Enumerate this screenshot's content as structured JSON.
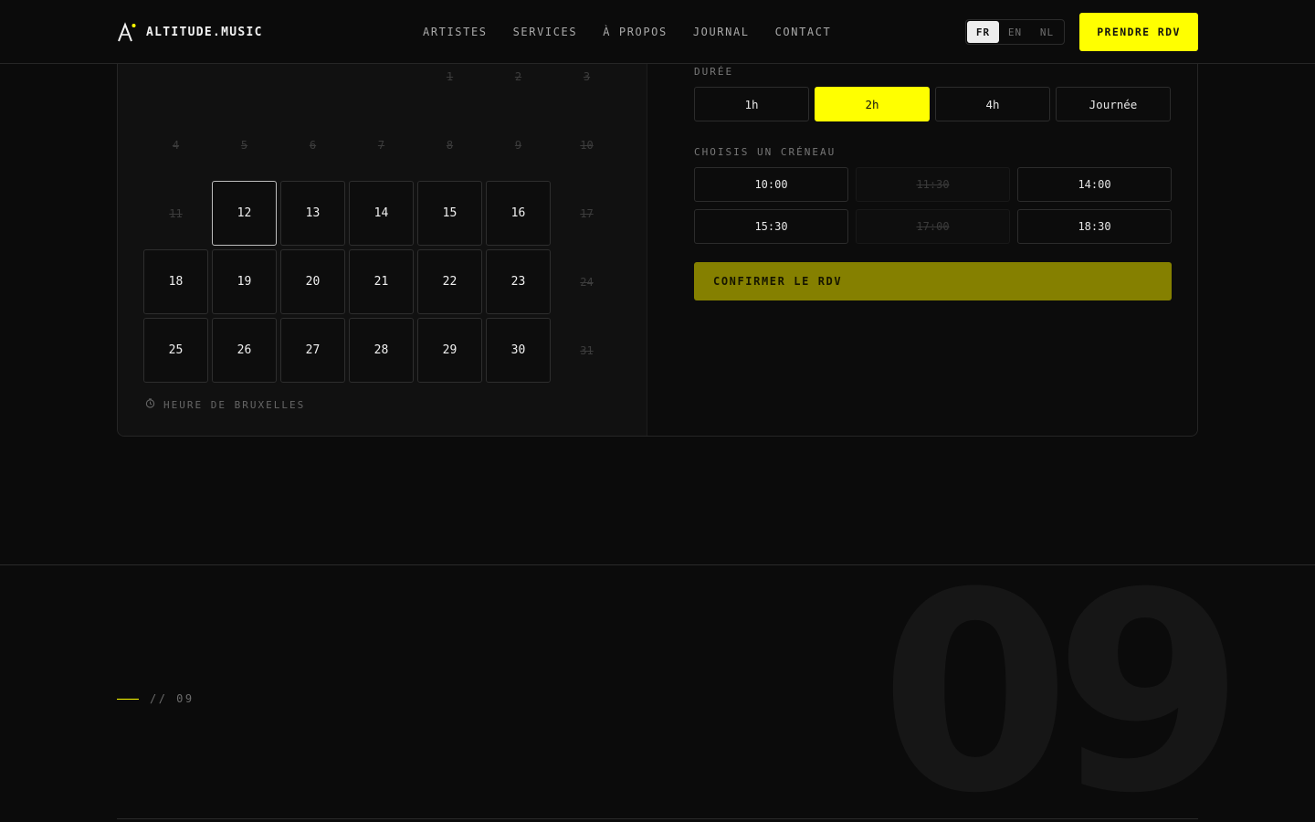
{
  "brand": {
    "name": "ALTITUDE.MUSIC",
    "accent": "#ffff00"
  },
  "nav": {
    "items": [
      "ARTISTES",
      "SERVICES",
      "À PROPOS",
      "JOURNAL",
      "CONTACT"
    ]
  },
  "lang": {
    "options": [
      "FR",
      "EN",
      "NL"
    ],
    "active": "FR"
  },
  "cta": {
    "label": "PRENDRE RDV"
  },
  "calendar": {
    "rows": [
      [
        {
          "d": ""
        },
        {
          "d": ""
        },
        {
          "d": ""
        },
        {
          "d": ""
        },
        {
          "d": "1",
          "s": "off"
        },
        {
          "d": "2",
          "s": "off"
        },
        {
          "d": "3",
          "s": "off"
        }
      ],
      [
        {
          "d": "4",
          "s": "off"
        },
        {
          "d": "5",
          "s": "off"
        },
        {
          "d": "6",
          "s": "off"
        },
        {
          "d": "7",
          "s": "off"
        },
        {
          "d": "8",
          "s": "off"
        },
        {
          "d": "9",
          "s": "off"
        },
        {
          "d": "10",
          "s": "off"
        }
      ],
      [
        {
          "d": "11",
          "s": "off"
        },
        {
          "d": "12",
          "s": "sel"
        },
        {
          "d": "13",
          "s": "avail"
        },
        {
          "d": "14",
          "s": "avail"
        },
        {
          "d": "15",
          "s": "avail"
        },
        {
          "d": "16",
          "s": "avail"
        },
        {
          "d": "17",
          "s": "off"
        }
      ],
      [
        {
          "d": "18",
          "s": "avail"
        },
        {
          "d": "19",
          "s": "avail"
        },
        {
          "d": "20",
          "s": "avail"
        },
        {
          "d": "21",
          "s": "avail"
        },
        {
          "d": "22",
          "s": "avail"
        },
        {
          "d": "23",
          "s": "avail"
        },
        {
          "d": "24",
          "s": "off"
        }
      ],
      [
        {
          "d": "25",
          "s": "avail"
        },
        {
          "d": "26",
          "s": "avail"
        },
        {
          "d": "27",
          "s": "avail"
        },
        {
          "d": "28",
          "s": "avail"
        },
        {
          "d": "29",
          "s": "avail"
        },
        {
          "d": "30",
          "s": "avail"
        },
        {
          "d": "31",
          "s": "off"
        }
      ]
    ],
    "timezone": "HEURE DE BRUXELLES"
  },
  "booking": {
    "duration_label": "DURÉE",
    "durations": [
      {
        "label": "1h",
        "active": false
      },
      {
        "label": "2h",
        "active": true
      },
      {
        "label": "4h",
        "active": false
      },
      {
        "label": "Journée",
        "active": false
      }
    ],
    "slot_label": "CHOISIS UN CRÉNEAU",
    "slots": [
      {
        "label": "10:00",
        "available": true
      },
      {
        "label": "11:30",
        "available": false
      },
      {
        "label": "14:00",
        "available": true
      },
      {
        "label": "15:30",
        "available": true
      },
      {
        "label": "17:00",
        "available": false
      },
      {
        "label": "18:30",
        "available": true
      }
    ],
    "confirm_label": "CONFIRMER LE RDV"
  },
  "section": {
    "tag": "// 09",
    "number": "09"
  }
}
